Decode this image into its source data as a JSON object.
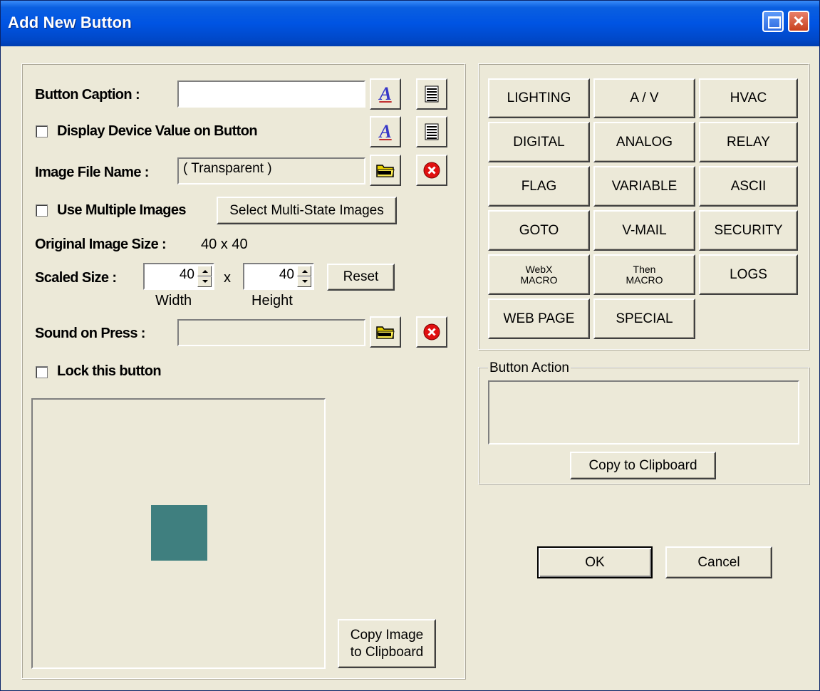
{
  "window": {
    "title": "Add New Button"
  },
  "form": {
    "caption_label": "Button Caption :",
    "caption_value": "",
    "display_value_label": "Display Device Value on Button",
    "image_file_label": "Image File Name :",
    "image_file_value": "( Transparent )",
    "multiple_images_label": "Use Multiple Images",
    "select_multi_state_label": "Select Multi-State Images",
    "original_size_label": "Original Image Size :",
    "original_size_value": "40 x 40",
    "scaled_size_label": "Scaled Size :",
    "width_value": "40",
    "height_value": "40",
    "times_sign": "x",
    "width_label": "Width",
    "height_label": "Height",
    "reset_label": "Reset",
    "sound_label": "Sound on Press :",
    "sound_value": "",
    "lock_label": "Lock this button",
    "preview_color": "#3F7F7F",
    "copy_image_line1": "Copy Image",
    "copy_image_line2": "to Clipboard"
  },
  "categories": {
    "lighting": "LIGHTING",
    "av": "A / V",
    "hvac": "HVAC",
    "digital": "DIGITAL",
    "analog": "ANALOG",
    "relay": "RELAY",
    "flag": "FLAG",
    "variable": "VARIABLE",
    "ascii": "ASCII",
    "goto": "GOTO",
    "vmail": "V-MAIL",
    "security": "SECURITY",
    "webx_line1": "WebX",
    "webx_line2": "MACRO",
    "then_line1": "Then",
    "then_line2": "MACRO",
    "logs": "LOGS",
    "web_page": "WEB PAGE",
    "special": "SPECIAL"
  },
  "action": {
    "legend": "Button Action",
    "value": "",
    "copy_label": "Copy to Clipboard"
  },
  "dialog": {
    "ok_label": "OK",
    "cancel_label": "Cancel"
  },
  "icons": {
    "font": "font-style-icon",
    "align": "text-align-icon",
    "folder": "folder-icon",
    "delete": "delete-icon"
  }
}
